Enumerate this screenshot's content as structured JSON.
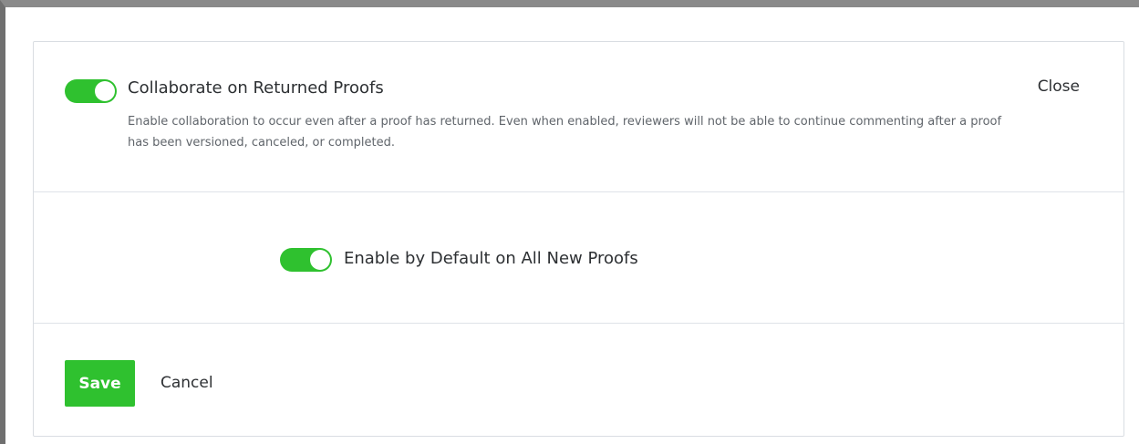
{
  "collaborate": {
    "enabled": true,
    "title": "Collaborate on Returned Proofs",
    "description": "Enable collaboration to occur even after a proof has returned. Even when enabled, reviewers will not be able to continue commenting after a proof has been versioned, canceled, or completed.",
    "close_label": "Close"
  },
  "default_setting": {
    "enabled": true,
    "label": "Enable by Default on All New Proofs"
  },
  "actions": {
    "save_label": "Save",
    "cancel_label": "Cancel"
  },
  "colors": {
    "accent": "#2fc12f",
    "text": "#2d3033",
    "muted_text": "#60656b",
    "border": "#dfe3e8"
  }
}
